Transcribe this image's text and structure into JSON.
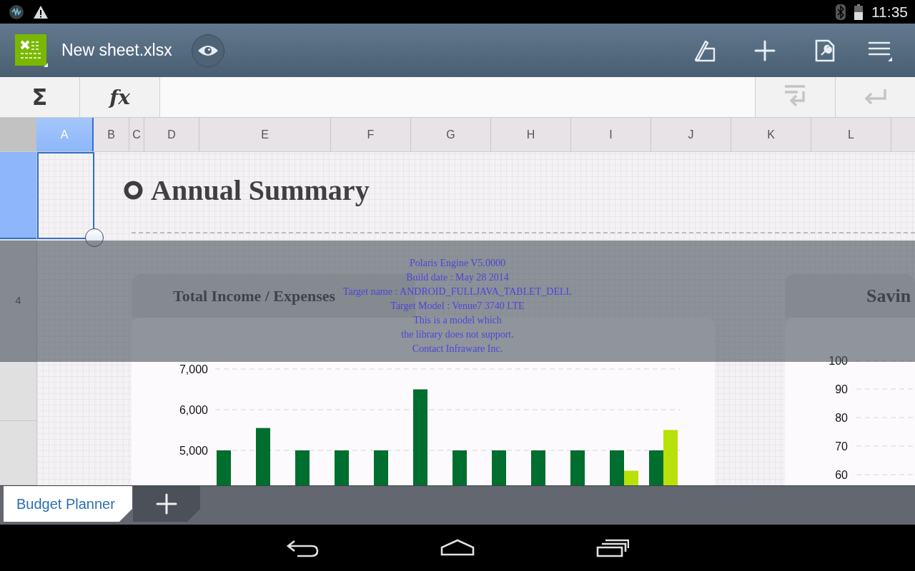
{
  "status_bar": {
    "time": "11:35"
  },
  "app_bar": {
    "title": "New sheet.xlsx"
  },
  "formula_bar": {
    "left_buttons": [
      {
        "label": "Σ"
      },
      {
        "label": "fx"
      }
    ],
    "right_buttons": [
      {
        "kind": "wrap",
        "disabled": true
      },
      {
        "kind": "enter",
        "disabled": true
      }
    ]
  },
  "columns": [
    {
      "label": "A",
      "selected": true
    },
    {
      "label": "B",
      "selected": false
    },
    {
      "label": "C",
      "selected": false
    },
    {
      "label": "D",
      "selected": false
    },
    {
      "label": "E",
      "selected": false
    },
    {
      "label": "F",
      "selected": false
    },
    {
      "label": "G",
      "selected": false
    },
    {
      "label": "H",
      "selected": false
    },
    {
      "label": "I",
      "selected": false
    },
    {
      "label": "J",
      "selected": false
    },
    {
      "label": "K",
      "selected": false
    },
    {
      "label": "L",
      "selected": false
    }
  ],
  "rows": [
    {
      "selected": true
    },
    {
      "label": "4",
      "selected": false
    },
    {
      "selected": false
    },
    {
      "selected": false
    }
  ],
  "sheet": {
    "title": "Annual Summary",
    "chart_1": {
      "chart_data": {
        "type": "bar",
        "title": "Total Income / Expenses",
        "ylim": [
          0,
          7000
        ],
        "yticks": [
          {
            "value": 5000,
            "label": "5,000"
          },
          {
            "value": 6000,
            "label": "6,000"
          },
          {
            "value": 7000,
            "label": "7,000"
          }
        ],
        "series": [
          {
            "color": "#006e2e",
            "values": [
              5000,
              5550,
              5000,
              5000,
              5000,
              6500,
              5000,
              5000,
              5000,
              5000,
              5000,
              5000
            ]
          },
          {
            "color": "#b8e00a",
            "values": [
              null,
              null,
              null,
              null,
              null,
              null,
              null,
              null,
              null,
              null,
              4500,
              5500
            ]
          }
        ]
      }
    },
    "chart_2": {
      "title": "Savin",
      "y_ticks": [
        "100",
        "90",
        "80",
        "70",
        "60"
      ]
    }
  },
  "engine_notice": [
    "Polaris Engine V5.0000",
    "Build date : May 28 2014",
    "Target name : ANDROID_FULLJAVA_TABLET_DELL",
    "Target Model : Venue7 3740 LTE",
    "This is a model which",
    "the library does not support.",
    "Contact Infraware Inc."
  ],
  "sheet_tabs": [
    {
      "label": "Budget Planner",
      "selected": true
    }
  ]
}
